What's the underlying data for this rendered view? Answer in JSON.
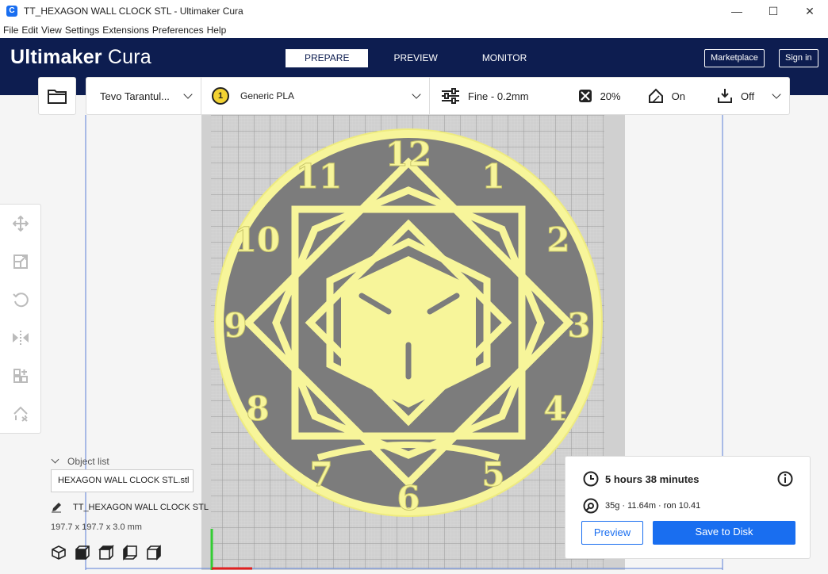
{
  "window": {
    "title": "TT_HEXAGON WALL CLOCK STL - Ultimaker Cura",
    "minimize": "—",
    "maximize": "☐",
    "close": "✕"
  },
  "menu": [
    "File",
    "Edit",
    "View",
    "Settings",
    "Extensions",
    "Preferences",
    "Help"
  ],
  "header": {
    "logo_bold": "Ultimaker",
    "logo_light": " Cura",
    "tabs": [
      "PREPARE",
      "PREVIEW",
      "MONITOR"
    ],
    "marketplace": "Marketplace",
    "signin": "Sign in"
  },
  "toolbar": {
    "printer": "Tevo Tarantul...",
    "extruder_number": "1",
    "material": "Generic PLA",
    "profile": "Fine - 0.2mm",
    "infill": "20%",
    "support": "On",
    "adhesion": "Off"
  },
  "clock": {
    "numbers": [
      "12",
      "1",
      "2",
      "3",
      "4",
      "5",
      "6",
      "7",
      "8",
      "9",
      "10",
      "11"
    ],
    "color": "#f7f59a"
  },
  "object_list": {
    "header": "Object list",
    "selected": "HEXAGON WALL CLOCK STL.stl",
    "name": "TT_HEXAGON WALL CLOCK STL",
    "dimensions": "197.7 x 197.7 x 3.0 mm"
  },
  "print": {
    "time": "5 hours 38 minutes",
    "material": "35g · 11.64m · ron 10.41",
    "preview": "Preview",
    "save": "Save to Disk"
  },
  "colors": {
    "header": "#0d1d50",
    "accent": "#196ef0",
    "model": "#f7f59a"
  }
}
